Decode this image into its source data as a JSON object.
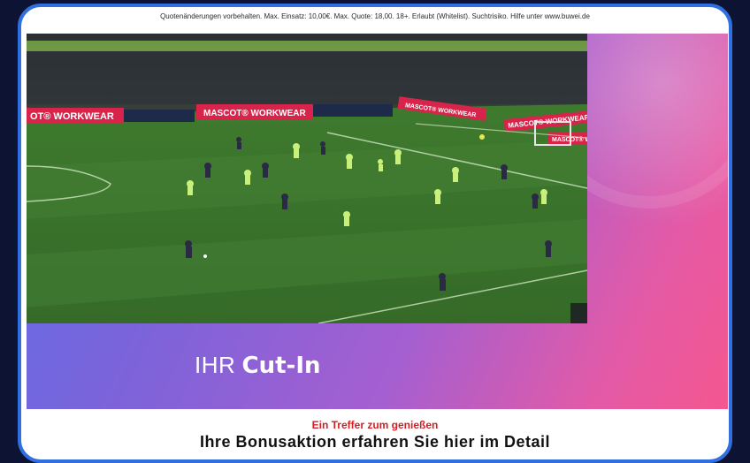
{
  "disclaimer": "Quotenänderungen vorbehalten. Max. Einsatz: 10,00€. Max. Quote: 18,00. 18+. Erlaubt (Whitelist). Suchtrisiko. Hilfe unter www.buwei.de",
  "video": {
    "boards": {
      "left": "OT® WORKWEAR",
      "center": "MASCOT® WORKWEAR",
      "right1": "MASCOT® WORKWEAR",
      "right2": "MASCOT® WORKWEAR",
      "right3": "MASCOT® WORKWEAR"
    }
  },
  "cutin": {
    "prefix": "IHR",
    "highlight": "Cut-In"
  },
  "bottom": {
    "line1": "Ein Treffer zum genießen",
    "line2": "Ihre Bonusaktion erfahren Sie hier im Detail"
  },
  "colors": {
    "frame_border": "#2f6fe0",
    "page_background": "#0d1433",
    "gradient_start": "#5e6fe6",
    "gradient_end": "#f4578f",
    "bottom_red": "#d21f26"
  }
}
